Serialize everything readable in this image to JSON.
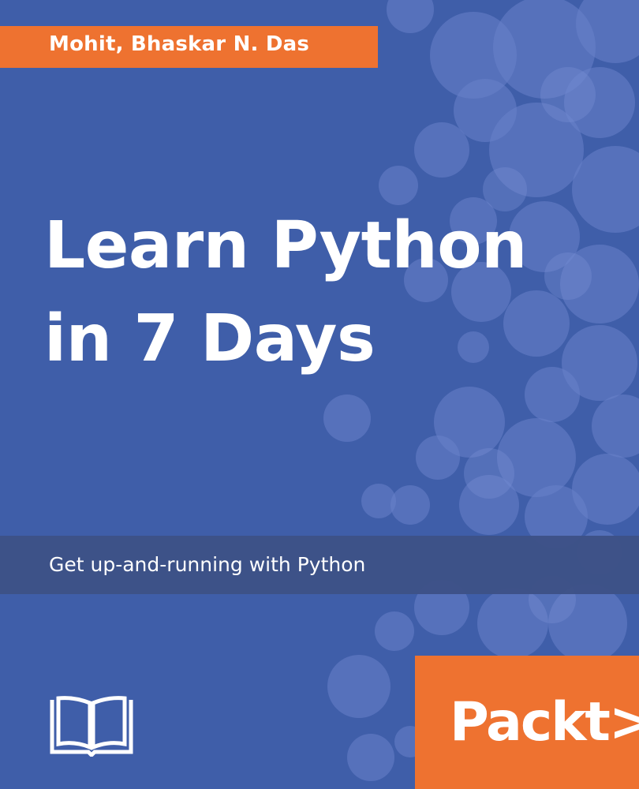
{
  "cover": {
    "author": "Mohit, Bhaskar N. Das",
    "title_lines": [
      "Learn Python",
      "in 7 Days"
    ],
    "subtitle": "Get up-and-running with Python",
    "publisher": "Packt>",
    "icons": {
      "book": "open-book-icon"
    }
  },
  "colors": {
    "background": "#3f5ea9",
    "accent_orange": "#ee7230",
    "subtitle_band": "#3d5186",
    "bubble": "#6b83cc",
    "text": "#ffffff"
  }
}
